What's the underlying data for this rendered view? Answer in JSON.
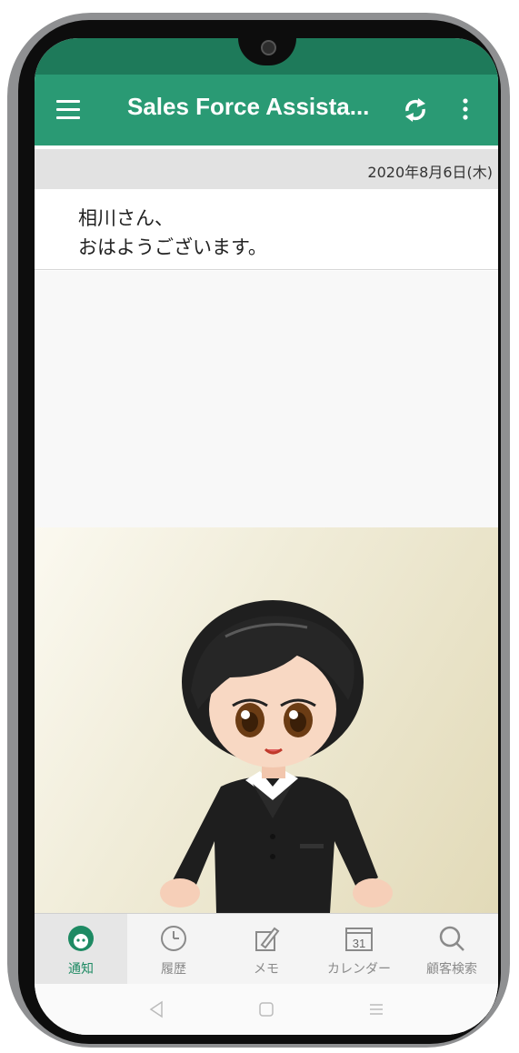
{
  "app": {
    "title": "Sales Force Assista...",
    "accent_color": "#2a9a74",
    "status_color": "#1e7a5a"
  },
  "header": {
    "menu_icon": "hamburger-menu-icon",
    "sync_icon": "sync-icon",
    "more_icon": "more-vertical-icon"
  },
  "date": "2020年8月6日(木)",
  "greeting": {
    "line1": "相川さん、",
    "line2": "おはようございます。"
  },
  "bottom_nav": {
    "items": [
      {
        "label": "通知",
        "icon": "avatar-face-icon",
        "active": true
      },
      {
        "label": "履歴",
        "icon": "history-clock-icon",
        "active": false
      },
      {
        "label": "メモ",
        "icon": "memo-pencil-icon",
        "active": false
      },
      {
        "label": "カレンダー",
        "icon": "calendar-icon",
        "calendar_day": "31",
        "active": false
      },
      {
        "label": "顧客検索",
        "icon": "search-icon",
        "active": false
      }
    ]
  },
  "system_nav": [
    "back-icon",
    "home-icon",
    "recents-icon"
  ]
}
